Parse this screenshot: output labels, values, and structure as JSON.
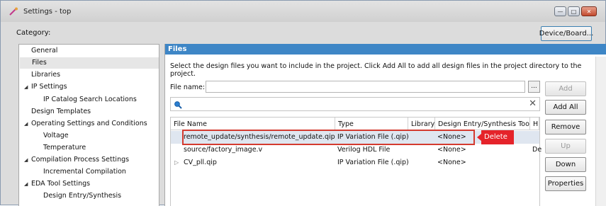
{
  "window": {
    "title": "Settings - top",
    "icon": "app-icon",
    "controls": [
      {
        "name": "minimize",
        "glyph": "—"
      },
      {
        "name": "maximize",
        "glyph": "□"
      },
      {
        "name": "close",
        "glyph": "✕"
      }
    ]
  },
  "category_label": "Category:",
  "device_button": "Device/Board...",
  "sidebar": {
    "items": [
      {
        "label": "General",
        "level": 0,
        "expandable": false,
        "selected": false
      },
      {
        "label": "Files",
        "level": 0,
        "expandable": false,
        "selected": true
      },
      {
        "label": "Libraries",
        "level": 0,
        "expandable": false,
        "selected": false
      },
      {
        "label": "IP Settings",
        "level": 0,
        "expandable": true,
        "selected": false
      },
      {
        "label": "IP Catalog Search Locations",
        "level": 1,
        "expandable": false,
        "selected": false
      },
      {
        "label": "Design Templates",
        "level": 0,
        "expandable": false,
        "selected": false
      },
      {
        "label": "Operating Settings and Conditions",
        "level": 0,
        "expandable": true,
        "selected": false
      },
      {
        "label": "Voltage",
        "level": 1,
        "expandable": false,
        "selected": false
      },
      {
        "label": "Temperature",
        "level": 1,
        "expandable": false,
        "selected": false
      },
      {
        "label": "Compilation Process Settings",
        "level": 0,
        "expandable": true,
        "selected": false
      },
      {
        "label": "Incremental Compilation",
        "level": 1,
        "expandable": false,
        "selected": false
      },
      {
        "label": "EDA Tool Settings",
        "level": 0,
        "expandable": true,
        "selected": false
      },
      {
        "label": "Design Entry/Synthesis",
        "level": 1,
        "expandable": false,
        "selected": false
      }
    ]
  },
  "panel": {
    "title": "Files",
    "instructions": "Select the design files you want to include in the project. Click Add All to add all design files in the project directory to the project.",
    "file_name_label": "File name:",
    "file_name_value": "",
    "browse_label": "...",
    "search_value": "",
    "table": {
      "columns": [
        "File Name",
        "Type",
        "Library",
        "Design Entry/Synthesis Tool",
        "HD"
      ],
      "rows": [
        {
          "file": "remote_update/synthesis/remote_update.qip",
          "type": "IP Variation File (.qip)",
          "library": "",
          "tool": "<None>",
          "hdl": "",
          "expandable": false
        },
        {
          "file": "source/factory_image.v",
          "type": "Verilog HDL File",
          "library": "",
          "tool": "<None>",
          "hdl": "De",
          "expandable": false
        },
        {
          "file": "CV_pll.qip",
          "type": "IP Variation File (.qip)",
          "library": "",
          "tool": "<None>",
          "hdl": "",
          "expandable": true
        }
      ]
    },
    "callout": "Delete",
    "buttons": {
      "add": "Add",
      "add_all": "Add All",
      "remove": "Remove",
      "up": "Up",
      "down": "Down",
      "properties": "Properties"
    }
  },
  "colors": {
    "header_blue": "#3e86c6",
    "callout_red": "#e5232a",
    "selected_row": "#dfe6f0"
  }
}
